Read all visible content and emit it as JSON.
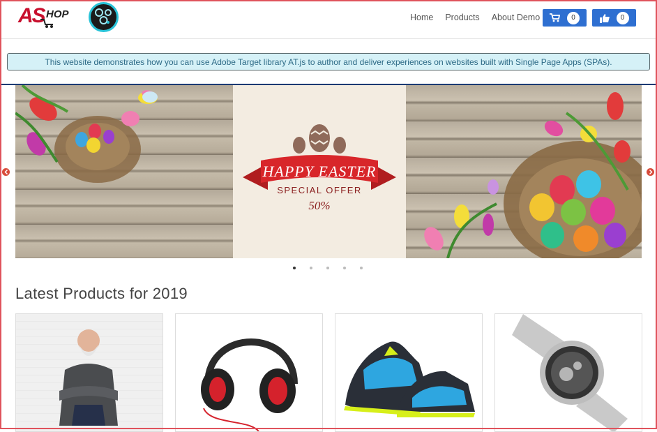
{
  "header": {
    "logo_text": "AS",
    "logo_suffix": "HOP",
    "nav": [
      {
        "label": "Home"
      },
      {
        "label": "Products"
      },
      {
        "label": "About Demo"
      }
    ],
    "cart_count": "0",
    "likes_count": "0"
  },
  "info_banner": "This website demonstrates how you can use Adobe Target library AT.js to author and deliver experiences on websites built with Single Page Apps (SPAs).",
  "carousel": {
    "slide_headline": "HAPPY EASTER",
    "slide_subline": "SPECIAL OFFER",
    "slide_discount": "50%",
    "slide_count": 5,
    "active_slide": 1
  },
  "section_title": "Latest Products for 2019",
  "products": [
    {
      "image": "man-in-cardigan"
    },
    {
      "image": "headphones"
    },
    {
      "image": "sneakers"
    },
    {
      "image": "wristwatch"
    }
  ],
  "colors": {
    "brand_red": "#c8102e",
    "accent_blue": "#2e6fd1",
    "info_bg": "#d5f1f7",
    "info_text": "#2d6a86",
    "ribbon_red": "#d8262a"
  }
}
